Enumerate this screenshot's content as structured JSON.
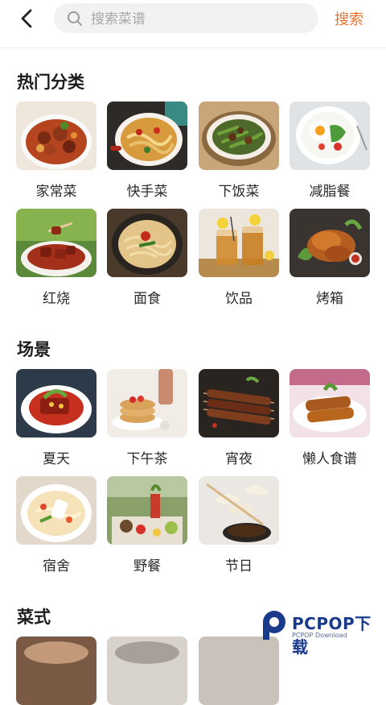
{
  "header": {
    "search_placeholder": "搜索菜谱",
    "search_button": "搜索"
  },
  "sections": {
    "hot": {
      "title": "热门分类"
    },
    "scene": {
      "title": "场景"
    },
    "style": {
      "title": "菜式"
    }
  },
  "hot_categories": [
    {
      "label": "家常菜",
      "icon": "braised-pork-stew-image"
    },
    {
      "label": "快手菜",
      "icon": "stir-fry-image"
    },
    {
      "label": "下饭菜",
      "icon": "green-beans-beef-image"
    },
    {
      "label": "减脂餐",
      "icon": "egg-salad-image"
    },
    {
      "label": "红烧",
      "icon": "braised-meat-image"
    },
    {
      "label": "面食",
      "icon": "noodles-image"
    },
    {
      "label": "饮品",
      "icon": "iced-tea-image"
    },
    {
      "label": "烤箱",
      "icon": "roast-chicken-image"
    }
  ],
  "scene_categories": [
    {
      "label": "夏天",
      "icon": "summer-dish-image"
    },
    {
      "label": "下午茶",
      "icon": "pancakes-image"
    },
    {
      "label": "宵夜",
      "icon": "skewers-image"
    },
    {
      "label": "懒人食谱",
      "icon": "lazy-recipe-image"
    },
    {
      "label": "宿舍",
      "icon": "dorm-noodle-image"
    },
    {
      "label": "野餐",
      "icon": "picnic-image"
    },
    {
      "label": "节日",
      "icon": "dumplings-image"
    }
  ],
  "watermark": {
    "text": "PCPOP下载",
    "sub": "PCPOP Download"
  },
  "colors": {
    "accent": "#e9722a",
    "search_bg": "#f2f2f2"
  }
}
